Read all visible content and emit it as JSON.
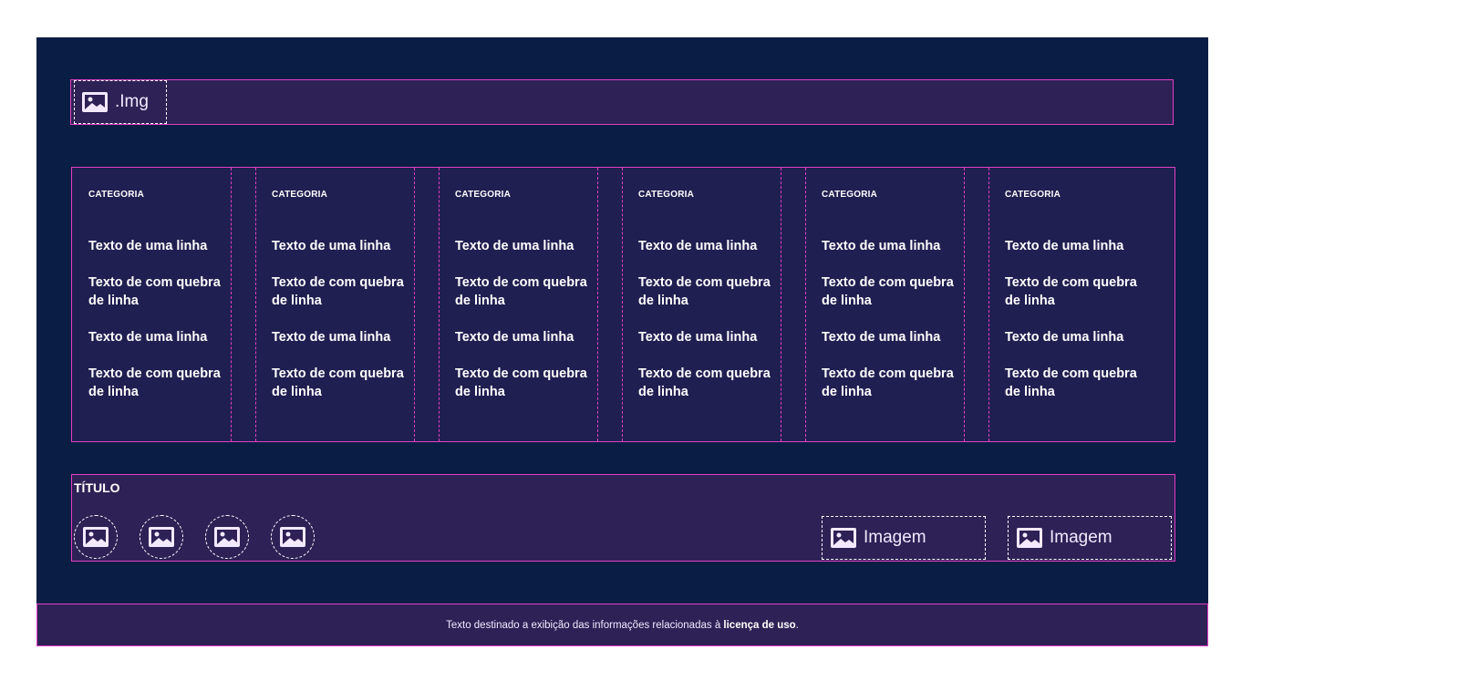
{
  "logo": {
    "label": ".Img",
    "icon": "image-icon"
  },
  "columns": [
    {
      "category": "CATEGORIA",
      "items": [
        "Texto de uma linha",
        "Texto de com quebra de linha",
        "Texto de uma linha",
        "Texto de com quebra de linha"
      ]
    },
    {
      "category": "CATEGORIA",
      "items": [
        "Texto de uma linha",
        "Texto de com quebra de linha",
        "Texto de uma linha",
        "Texto de com quebra de linha"
      ]
    },
    {
      "category": "CATEGORIA",
      "items": [
        "Texto de uma linha",
        "Texto de com quebra de linha",
        "Texto de uma linha",
        "Texto de com quebra de linha"
      ]
    },
    {
      "category": "CATEGORIA",
      "items": [
        "Texto de uma linha",
        "Texto de com quebra de linha",
        "Texto de uma linha",
        "Texto de com quebra de linha"
      ]
    },
    {
      "category": "CATEGORIA",
      "items": [
        "Texto de uma linha",
        "Texto de com quebra de linha",
        "Texto de uma linha",
        "Texto de com quebra de linha"
      ]
    },
    {
      "category": "CATEGORIA",
      "items": [
        "Texto de uma linha",
        "Texto de com quebra de linha",
        "Texto de uma linha",
        "Texto de com quebra de linha"
      ]
    }
  ],
  "social": {
    "title": "TÍTULO",
    "icons": [
      "image-icon",
      "image-icon",
      "image-icon",
      "image-icon"
    ],
    "badges": [
      {
        "label": "Imagem",
        "icon": "image-icon"
      },
      {
        "label": "Imagem",
        "icon": "image-icon"
      }
    ]
  },
  "license": {
    "text": "Texto destinado a exibição das informações relacionadas à ",
    "bold": "licença de uso",
    "end": "."
  },
  "colors": {
    "background": "#0a1d44",
    "panel": "#2e2156",
    "columns_panel": "#201f51",
    "accent": "#e23fc4",
    "text": "#ffffff"
  }
}
